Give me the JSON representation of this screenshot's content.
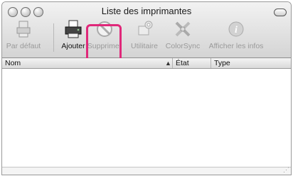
{
  "window": {
    "title": "Liste des imprimantes"
  },
  "toolbar": {
    "items": [
      {
        "label": "Par défaut",
        "icon": "printer-default-icon"
      },
      {
        "label": "Ajouter",
        "icon": "printer-add-icon"
      },
      {
        "label": "Supprimer",
        "icon": "delete-prohibited-icon"
      },
      {
        "label": "Utilitaire",
        "icon": "utility-gears-icon"
      },
      {
        "label": "ColorSync",
        "icon": "colorsync-tools-icon"
      },
      {
        "label": "Afficher les infos",
        "icon": "info-icon"
      }
    ]
  },
  "table": {
    "columns": [
      {
        "label": "Nom"
      },
      {
        "label": "État"
      },
      {
        "label": "Type"
      }
    ],
    "rows": []
  },
  "colors": {
    "highlight": "#e0287a"
  }
}
